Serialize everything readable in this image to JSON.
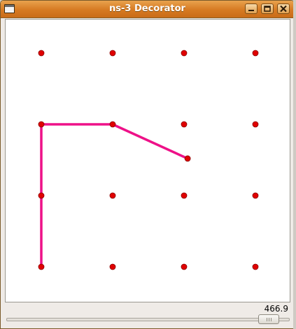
{
  "window": {
    "title": "ns-3 Decorator",
    "accent_color": "#d67a22",
    "buttons": [
      {
        "icon": "minimize-icon"
      },
      {
        "icon": "maximize-icon"
      },
      {
        "icon": "close-icon"
      }
    ]
  },
  "canvas": {
    "node_color": "#e00000",
    "path_color": "#ee1188",
    "grid_nodes": [
      [
        0,
        0
      ],
      [
        1,
        0
      ],
      [
        2,
        0
      ],
      [
        3,
        0
      ],
      [
        0,
        1
      ],
      [
        1,
        1
      ],
      [
        2,
        1
      ],
      [
        3,
        1
      ],
      [
        0,
        2
      ],
      [
        1,
        2
      ],
      [
        2,
        2
      ],
      [
        3,
        2
      ],
      [
        0,
        3
      ],
      [
        1,
        3
      ],
      [
        2,
        3
      ],
      [
        3,
        3
      ]
    ],
    "moving_node": [
      2.05,
      1.48
    ],
    "path": [
      [
        0,
        3
      ],
      [
        0,
        1
      ],
      [
        1,
        1
      ],
      [
        2.05,
        1.48
      ]
    ]
  },
  "time": {
    "value": "466.9",
    "slider_fraction": 0.96
  }
}
